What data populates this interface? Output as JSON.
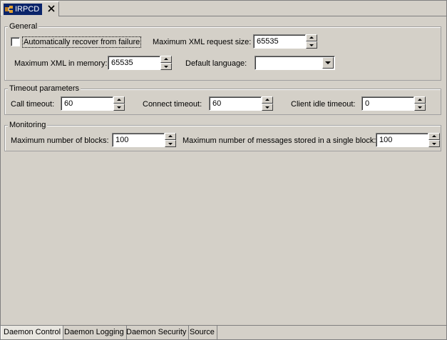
{
  "editor_tab": {
    "title": "IRPCD",
    "icon": "irpcd-icon",
    "close_icon": "close-icon"
  },
  "general": {
    "title": "General",
    "auto_recover": {
      "label": "Automatically recover from failure",
      "checked": false
    },
    "max_xml_request": {
      "label": "Maximum XML request size:",
      "value": "65535"
    },
    "max_xml_memory": {
      "label": "Maximum XML in memory:",
      "value": "65535"
    },
    "default_language": {
      "label": "Default language:",
      "value": ""
    }
  },
  "timeouts": {
    "title": "Timeout parameters",
    "call": {
      "label": "Call timeout:",
      "value": "60"
    },
    "connect": {
      "label": "Connect timeout:",
      "value": "60"
    },
    "client_idle": {
      "label": "Client idle timeout:",
      "value": "0"
    }
  },
  "monitoring": {
    "title": "Monitoring",
    "max_blocks": {
      "label": "Maximum number of blocks:",
      "value": "100"
    },
    "max_messages": {
      "label": "Maximum number of messages stored in a single block:",
      "value": "100"
    }
  },
  "bottom_tabs": [
    {
      "label": "Daemon Control",
      "active": true
    },
    {
      "label": "Daemon Logging",
      "active": false
    },
    {
      "label": "Daemon Security",
      "active": false
    },
    {
      "label": "Source",
      "active": false
    }
  ]
}
